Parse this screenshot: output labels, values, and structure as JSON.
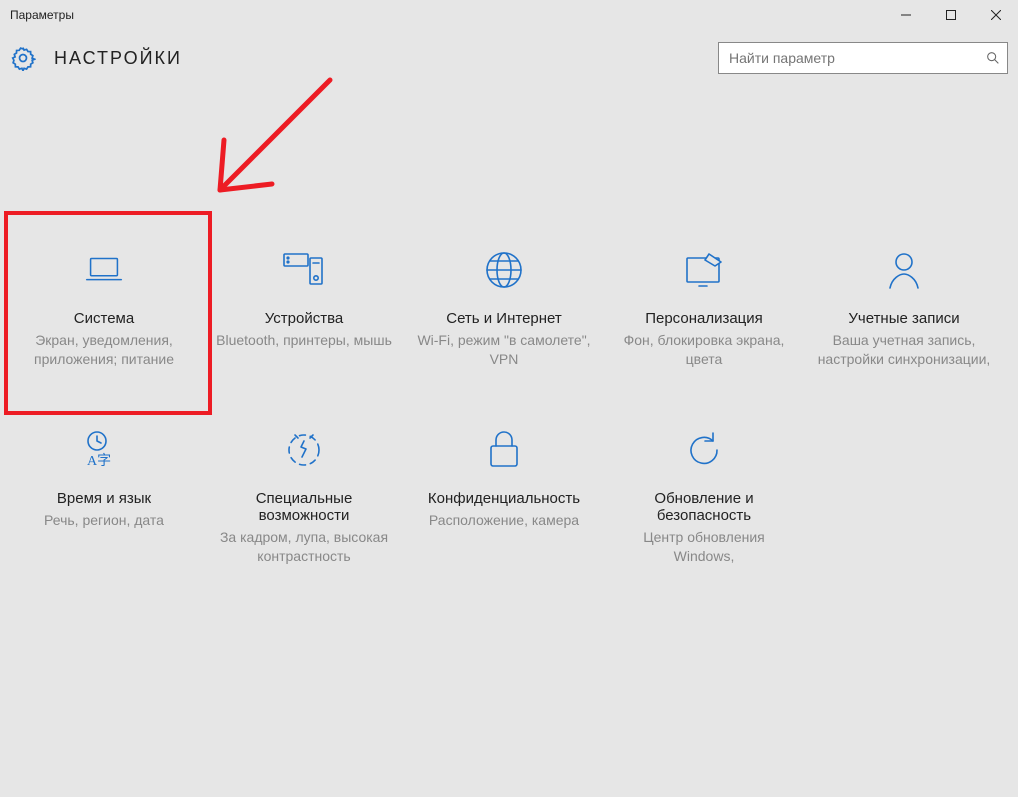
{
  "window": {
    "title": "Параметры"
  },
  "header": {
    "title": "НАСТРОЙКИ"
  },
  "search": {
    "placeholder": "Найти параметр"
  },
  "tiles": [
    {
      "icon": "laptop",
      "title": "Система",
      "desc": "Экран, уведомления, приложения; питание"
    },
    {
      "icon": "devices",
      "title": "Устройства",
      "desc": "Bluetooth, принтеры, мышь"
    },
    {
      "icon": "globe",
      "title": "Сеть и Интернет",
      "desc": "Wi-Fi, режим \"в самолете\", VPN"
    },
    {
      "icon": "personalize",
      "title": "Персонализация",
      "desc": "Фон, блокировка экрана, цвета"
    },
    {
      "icon": "accounts",
      "title": "Учетные записи",
      "desc": "Ваша учетная запись, настройки синхронизации,"
    },
    {
      "icon": "time",
      "title": "Время и язык",
      "desc": "Речь, регион, дата"
    },
    {
      "icon": "access",
      "title": "Специальные возможности",
      "desc": "За кадром, лупа, высокая контрастность"
    },
    {
      "icon": "privacy",
      "title": "Конфиденциальность",
      "desc": "Расположение, камера"
    },
    {
      "icon": "update",
      "title": "Обновление и безопасность",
      "desc": "Центр обновления Windows,"
    }
  ],
  "annotation": {
    "highlighted_tile_index": 0,
    "highlight_color": "#ed1c24"
  }
}
